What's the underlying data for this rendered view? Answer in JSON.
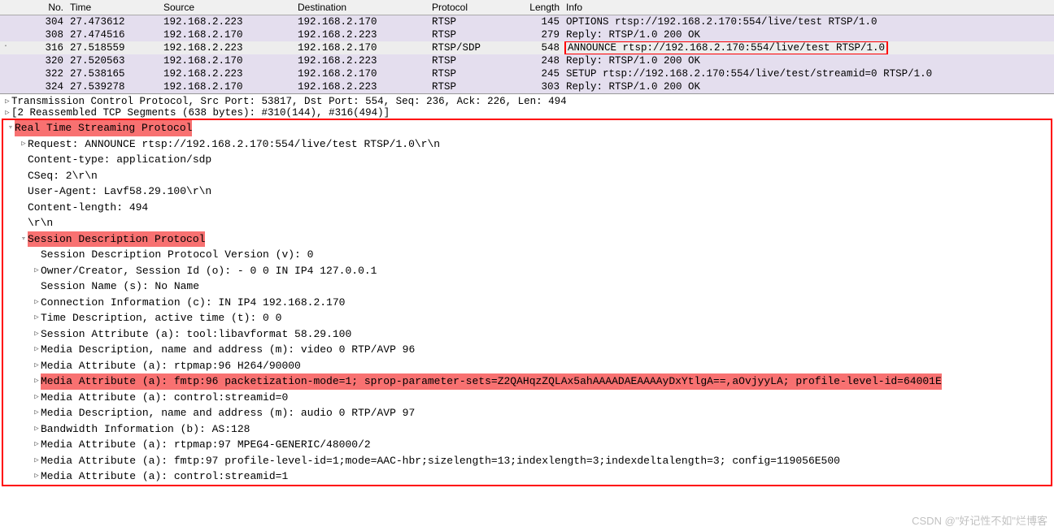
{
  "columns": {
    "no": "No.",
    "time": "Time",
    "src": "Source",
    "dst": "Destination",
    "proto": "Protocol",
    "len": "Length",
    "info": "Info"
  },
  "packets": [
    {
      "no": "304",
      "time": "27.473612",
      "src": "192.168.2.223",
      "dst": "192.168.2.170",
      "proto": "RTSP",
      "len": "145",
      "info": "OPTIONS rtsp://192.168.2.170:554/live/test RTSP/1.0",
      "cls": "row-purple"
    },
    {
      "no": "308",
      "time": "27.474516",
      "src": "192.168.2.170",
      "dst": "192.168.2.223",
      "proto": "RTSP",
      "len": "279",
      "info": "Reply: RTSP/1.0 200 OK",
      "cls": "row-purple"
    },
    {
      "no": "316",
      "time": "27.518559",
      "src": "192.168.2.223",
      "dst": "192.168.2.170",
      "proto": "RTSP/SDP",
      "len": "548",
      "info": "ANNOUNCE rtsp://192.168.2.170:554/live/test RTSP/1.0",
      "cls": "row-selected",
      "highlight": true,
      "marker": "·"
    },
    {
      "no": "320",
      "time": "27.520563",
      "src": "192.168.2.170",
      "dst": "192.168.2.223",
      "proto": "RTSP",
      "len": "248",
      "info": "Reply: RTSP/1.0 200 OK",
      "cls": "row-purple"
    },
    {
      "no": "322",
      "time": "27.538165",
      "src": "192.168.2.223",
      "dst": "192.168.2.170",
      "proto": "RTSP",
      "len": "245",
      "info": "SETUP rtsp://192.168.2.170:554/live/test/streamid=0 RTSP/1.0",
      "cls": "row-purple"
    },
    {
      "no": "324",
      "time": "27.539278",
      "src": "192.168.2.170",
      "dst": "192.168.2.223",
      "proto": "RTSP",
      "len": "303",
      "info": "Reply: RTSP/1.0 200 OK",
      "cls": "row-purple"
    }
  ],
  "predetail": [
    {
      "toggle": "▷",
      "text": "Transmission Control Protocol, Src Port: 53817, Dst Port: 554, Seq: 236, Ack: 226, Len: 494"
    },
    {
      "toggle": "▷",
      "text": "[2 Reassembled TCP Segments (638 bytes): #310(144), #316(494)]"
    }
  ],
  "tree": [
    {
      "ind": 0,
      "toggle": "▿",
      "text": "Real Time Streaming Protocol",
      "hl": true
    },
    {
      "ind": 1,
      "toggle": "▷",
      "text": "Request: ANNOUNCE rtsp://192.168.2.170:554/live/test RTSP/1.0\\r\\n"
    },
    {
      "ind": 1,
      "toggle": "",
      "text": "Content-type: application/sdp"
    },
    {
      "ind": 1,
      "toggle": "",
      "text": "CSeq: 2\\r\\n"
    },
    {
      "ind": 1,
      "toggle": "",
      "text": "User-Agent: Lavf58.29.100\\r\\n"
    },
    {
      "ind": 1,
      "toggle": "",
      "text": "Content-length: 494"
    },
    {
      "ind": 1,
      "toggle": "",
      "text": "\\r\\n"
    },
    {
      "ind": 1,
      "toggle": "▿",
      "text": "Session Description Protocol",
      "hl": true
    },
    {
      "ind": 2,
      "toggle": "",
      "text": "Session Description Protocol Version (v): 0"
    },
    {
      "ind": 2,
      "toggle": "▷",
      "text": "Owner/Creator, Session Id (o): - 0 0 IN IP4 127.0.0.1"
    },
    {
      "ind": 2,
      "toggle": "",
      "text": "Session Name (s): No Name"
    },
    {
      "ind": 2,
      "toggle": "▷",
      "text": "Connection Information (c): IN IP4 192.168.2.170"
    },
    {
      "ind": 2,
      "toggle": "▷",
      "text": "Time Description, active time (t): 0 0"
    },
    {
      "ind": 2,
      "toggle": "▷",
      "text": "Session Attribute (a): tool:libavformat 58.29.100"
    },
    {
      "ind": 2,
      "toggle": "▷",
      "text": "Media Description, name and address (m): video 0 RTP/AVP 96"
    },
    {
      "ind": 2,
      "toggle": "▷",
      "text": "Media Attribute (a): rtpmap:96 H264/90000"
    },
    {
      "ind": 2,
      "toggle": "▷",
      "text": "Media Attribute (a): fmtp:96 packetization-mode=1; sprop-parameter-sets=Z2QAHqzZQLAx5ahAAAADAEAAAAyDxYtlgA==,aOvjyyLA; profile-level-id=64001E",
      "hl": true
    },
    {
      "ind": 2,
      "toggle": "▷",
      "text": "Media Attribute (a): control:streamid=0"
    },
    {
      "ind": 2,
      "toggle": "▷",
      "text": "Media Description, name and address (m): audio 0 RTP/AVP 97"
    },
    {
      "ind": 2,
      "toggle": "▷",
      "text": "Bandwidth Information (b): AS:128"
    },
    {
      "ind": 2,
      "toggle": "▷",
      "text": "Media Attribute (a): rtpmap:97 MPEG4-GENERIC/48000/2"
    },
    {
      "ind": 2,
      "toggle": "▷",
      "text": "Media Attribute (a): fmtp:97 profile-level-id=1;mode=AAC-hbr;sizelength=13;indexlength=3;indexdeltalength=3; config=119056E500"
    },
    {
      "ind": 2,
      "toggle": "▷",
      "text": "Media Attribute (a): control:streamid=1"
    }
  ],
  "watermark": "CSDN @\"好记性不如\"烂博客"
}
